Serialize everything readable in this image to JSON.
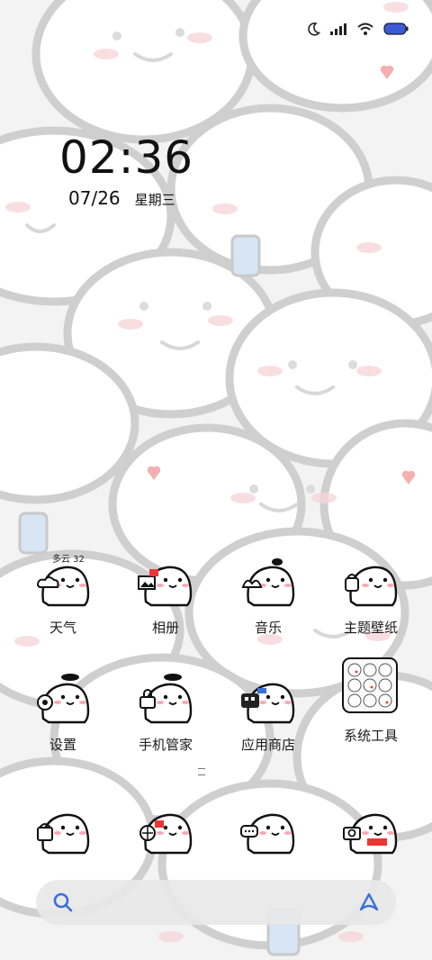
{
  "status_bar": {
    "icons": [
      "moon-icon",
      "signal-icon",
      "wifi-icon",
      "battery-icon"
    ],
    "battery_color": "#3b5bd6"
  },
  "lock": {
    "time": "02:36",
    "date": "07/26",
    "weekday": "星期三"
  },
  "weather": {
    "text": "多云 32"
  },
  "apps_row1": [
    {
      "label": "天气",
      "icon": "weather-icon"
    },
    {
      "label": "相册",
      "icon": "gallery-icon"
    },
    {
      "label": "音乐",
      "icon": "music-icon"
    },
    {
      "label": "主题壁纸",
      "icon": "theme-icon"
    }
  ],
  "apps_row2": [
    {
      "label": "设置",
      "icon": "settings-icon"
    },
    {
      "label": "手机管家",
      "icon": "security-icon"
    },
    {
      "label": "应用商店",
      "icon": "app-store-icon"
    },
    {
      "label": "系统工具",
      "icon": "system-tools-folder-icon"
    }
  ],
  "dock": [
    {
      "icon": "phone-icon"
    },
    {
      "icon": "browser-icon"
    },
    {
      "icon": "messages-icon"
    },
    {
      "icon": "camera-icon"
    }
  ],
  "search_bar": {
    "left_icon": "search-icon",
    "right_icon": "assistant-icon"
  },
  "colors": {
    "accent_blue": "#3b6fd8",
    "blush": "#f7b4bd",
    "outline": "#111111"
  }
}
